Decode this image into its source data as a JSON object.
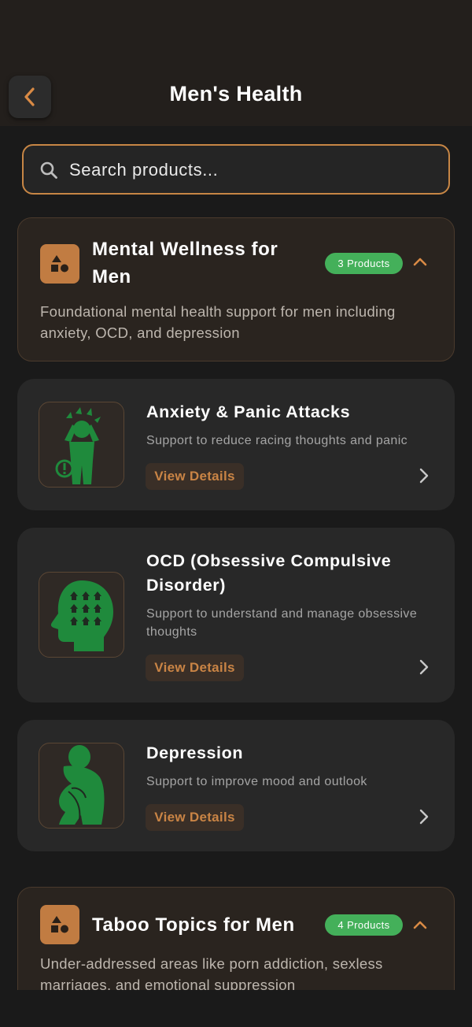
{
  "header": {
    "title": "Men's Health",
    "back_icon": "chevron-left-icon"
  },
  "search": {
    "placeholder": "Search products...",
    "value": "",
    "icon": "search-icon"
  },
  "colors": {
    "accent": "#c78645",
    "badge": "#44b05a",
    "product_icon": "#1f8a3c",
    "background": "#1a1a1a"
  },
  "categories": [
    {
      "title": "Mental Wellness for Men",
      "badge": "3 Products",
      "description": "Foundational mental health support for men including anxiety, OCD, and depression",
      "icon": "shapes-icon",
      "expanded": true,
      "products": [
        {
          "title": "Anxiety & Panic Attacks",
          "description": "Support to reduce racing thoughts and panic",
          "button": "View Details",
          "icon": "panic-person-icon"
        },
        {
          "title": "OCD (Obsessive Compulsive Disorder)",
          "description": "Support to understand and manage obsessive thoughts",
          "button": "View Details",
          "icon": "head-thoughts-icon"
        },
        {
          "title": "Depression",
          "description": "Support to improve mood and outlook",
          "button": "View Details",
          "icon": "sitting-person-icon"
        }
      ]
    },
    {
      "title": "Taboo Topics for Men",
      "badge": "4 Products",
      "description": "Under-addressed areas like porn addiction, sexless marriages, and emotional suppression",
      "icon": "shapes-icon",
      "expanded": true
    }
  ]
}
